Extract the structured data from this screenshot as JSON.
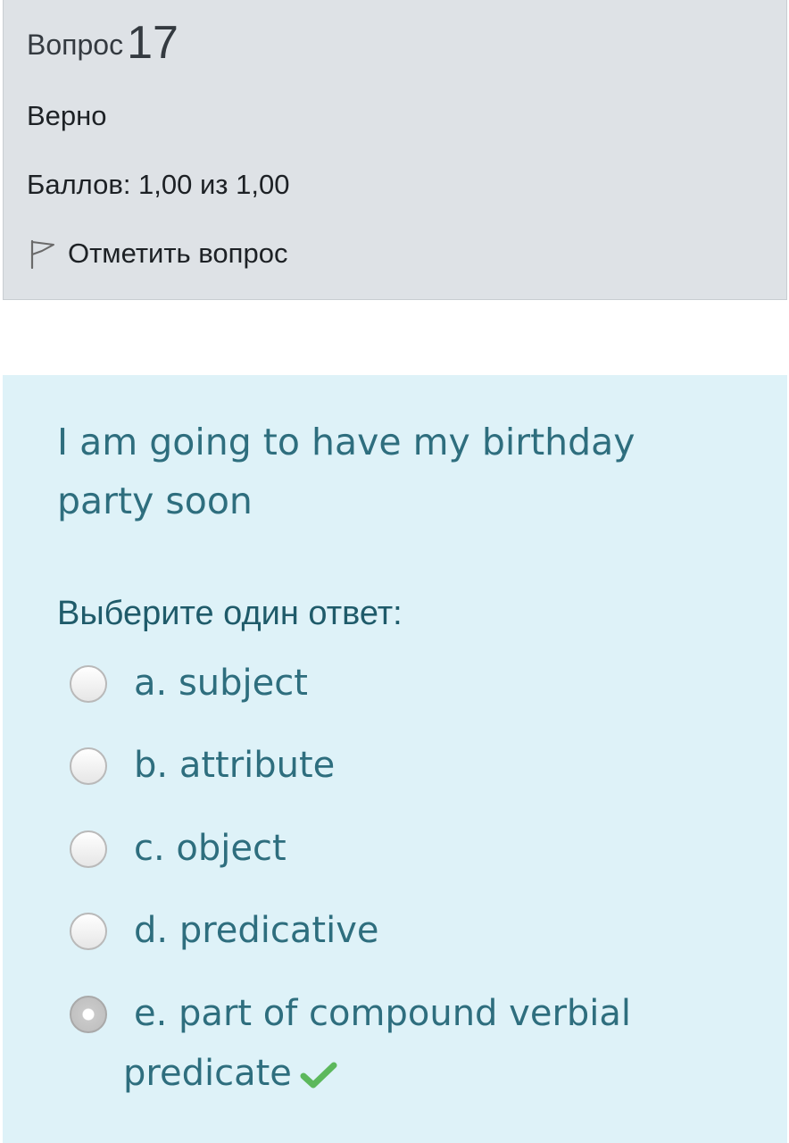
{
  "question_info": {
    "label": "Вопрос",
    "number": "17",
    "state": "Верно",
    "grade": "Баллов: 1,00 из 1,00",
    "flag_label": "Отметить вопрос",
    "flag_icon": "flag-icon"
  },
  "question": {
    "text": "I am going to have my birthday party soon",
    "prompt": "Выберите один ответ:",
    "options": [
      {
        "label": "a. subject",
        "selected": false
      },
      {
        "label": "b. attribute",
        "selected": false
      },
      {
        "label": "c. object",
        "selected": false
      },
      {
        "label": "d. predicative",
        "selected": false
      },
      {
        "label_line1": "e. part of compound verbial",
        "label_line2": "predicate",
        "selected": true,
        "correct_icon": "checkmark-icon"
      }
    ]
  },
  "colors": {
    "info_background": "#dee2e6",
    "content_background": "#def2f8",
    "text_teal": "#2e6e7e",
    "correct_green": "#5cb85c"
  }
}
